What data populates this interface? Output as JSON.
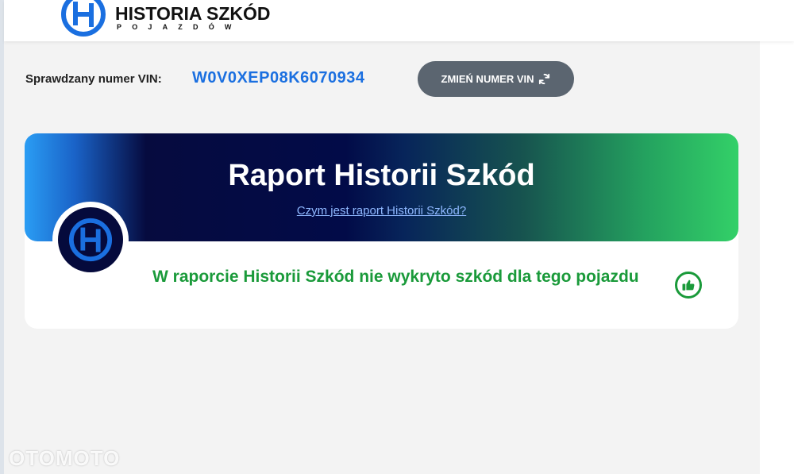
{
  "header": {
    "logo_title": "HISTORIA SZKÓD",
    "logo_subtitle": "POJAZDÓW",
    "logo_icon": "hs-logo-icon"
  },
  "vin": {
    "label": "Sprawdzany numer VIN:",
    "value": "W0V0XEP08K6070934",
    "change_button_label": "ZMIEŃ NUMER VIN",
    "change_button_icon": "refresh-icon"
  },
  "report": {
    "title": "Raport Historii Szkód",
    "info_link": "Czym jest raport Historii Szkód?",
    "result": "W raporcie Historii Szkód nie wykryto szkód dla tego pojazdu",
    "result_icon": "thumbs-up-icon",
    "result_color": "#1a9a3a"
  },
  "watermark": "OTOMOTO",
  "colors": {
    "accent_blue": "#1a6fe0",
    "button_gray": "#5b6570",
    "banner_dark": "#020b48",
    "banner_green": "#33d068"
  }
}
